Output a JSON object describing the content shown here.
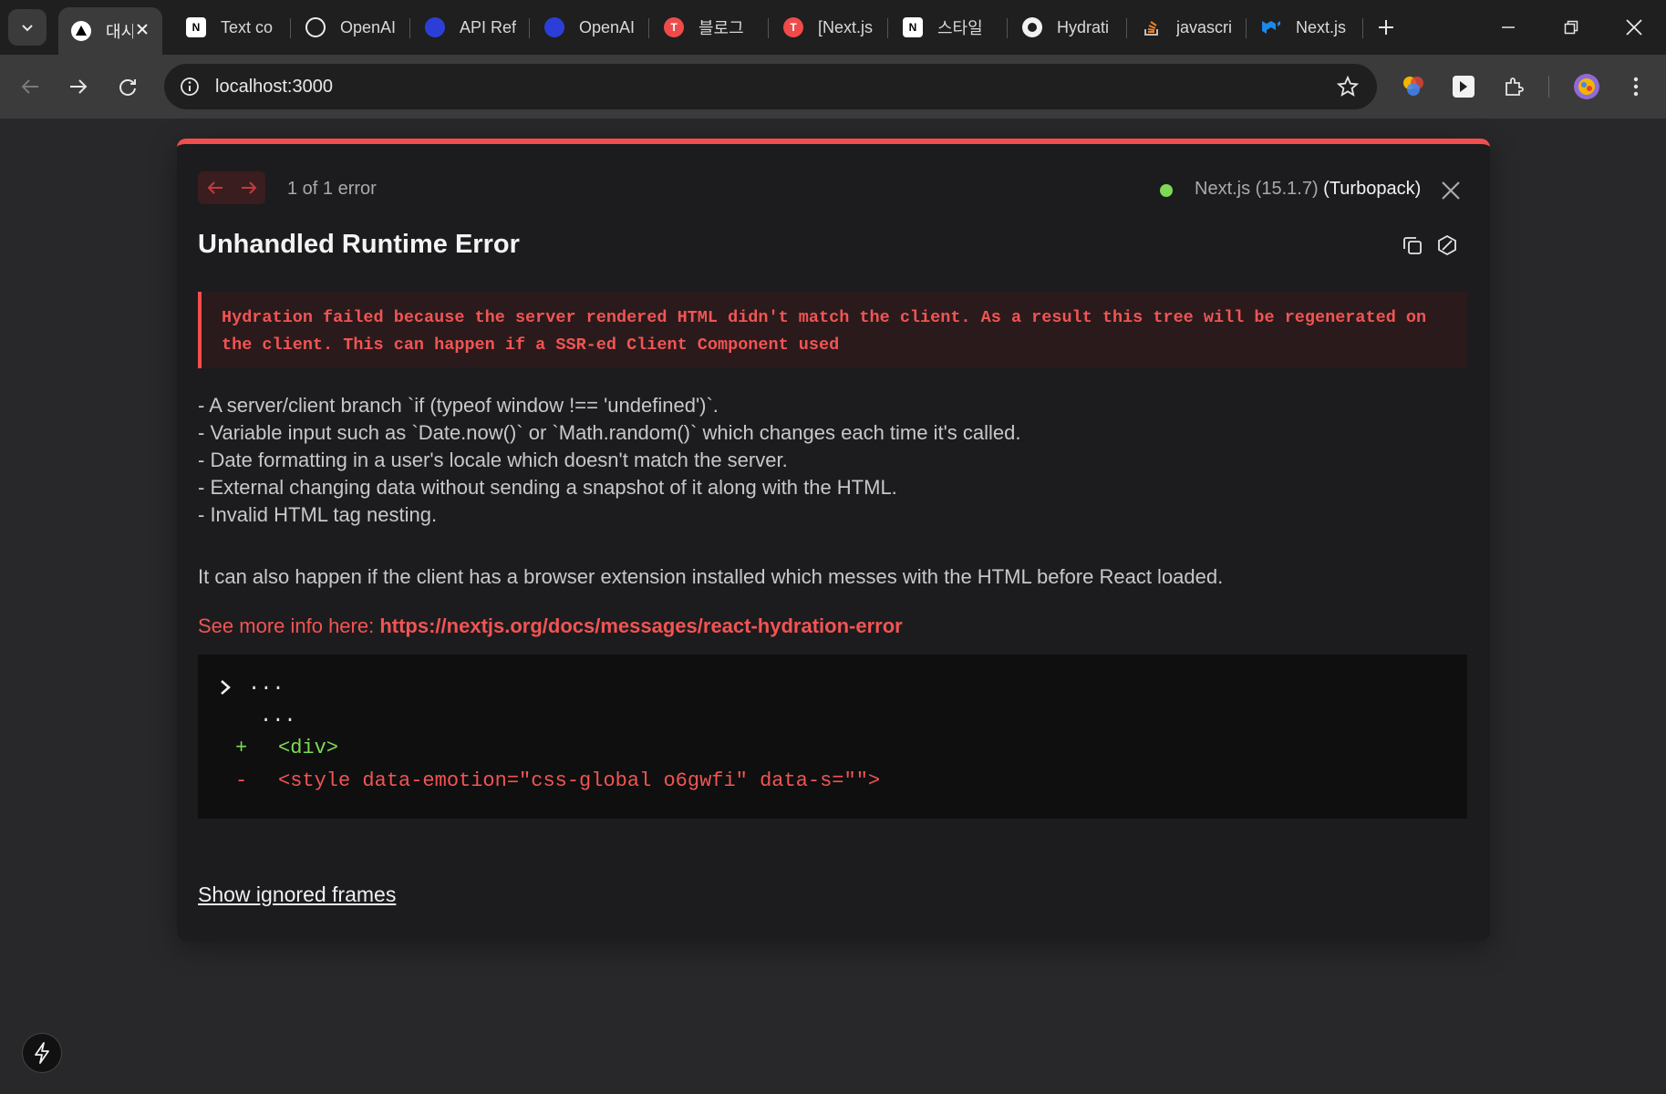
{
  "browser": {
    "tabs": [
      {
        "title": "대시보드",
        "icon": "nextjs-icon",
        "active": true
      },
      {
        "title": "Text co",
        "icon": "notion-icon"
      },
      {
        "title": "OpenAI",
        "icon": "openai-icon"
      },
      {
        "title": "API Ref",
        "icon": "openai-blue-icon"
      },
      {
        "title": "OpenAI",
        "icon": "openai-blue-icon"
      },
      {
        "title": "블로그",
        "icon": "tistory-icon"
      },
      {
        "title": "[Next.js",
        "icon": "tistory-icon"
      },
      {
        "title": "스타일",
        "icon": "notion-icon"
      },
      {
        "title": "Hydrati",
        "icon": "github-icon"
      },
      {
        "title": "javascri",
        "icon": "stackoverflow-icon"
      },
      {
        "title": "Next.js",
        "icon": "mui-icon"
      }
    ],
    "url": "localhost:3000"
  },
  "overlay": {
    "error_count": "1 of 1 error",
    "version_text": "Next.js (15.1.7)",
    "bundler": "(Turbopack)",
    "title": "Unhandled Runtime Error",
    "message": "Hydration failed because the server rendered HTML didn't match the client. As a result this tree will be regenerated on the client. This can happen if a SSR-ed Client Component used",
    "causes": [
      "- A server/client branch `if (typeof window !== 'undefined')`.",
      "- Variable input such as `Date.now()` or `Math.random()` which changes each time it's called.",
      "- Date formatting in a user's locale which doesn't match the server.",
      "- External changing data without sending a snapshot of it along with the HTML.",
      "- Invalid HTML tag nesting."
    ],
    "extension_note": "It can also happen if the client has a browser extension installed which messes with the HTML before React loaded.",
    "more_info_label": "See more info here: ",
    "more_info_link": "https://nextjs.org/docs/messages/react-hydration-error",
    "diff": {
      "line1": "...",
      "line2": "...",
      "plus_marker": "+",
      "plus_code": "<div>",
      "minus_marker": "-",
      "minus_code": "<style data-emotion=\"css-global o6gwfi\" data-s=\"\">"
    },
    "show_ignored": "Show ignored frames"
  },
  "colors": {
    "accent_red": "#f24e4e",
    "status_green": "#7ed957"
  }
}
